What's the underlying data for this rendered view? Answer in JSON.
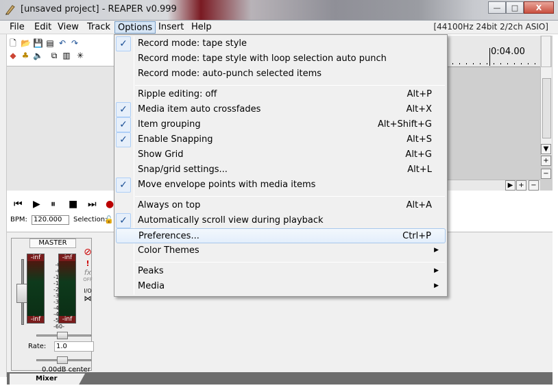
{
  "window": {
    "title": "[unsaved project] - REAPER v0.999",
    "minimize": "—",
    "maximize": "□",
    "close": "X"
  },
  "menubar": {
    "items": [
      "File",
      "Edit",
      "View",
      "Track",
      "Options",
      "Insert",
      "Help"
    ],
    "active": "Options",
    "status": "[44100Hz 24bit 2/2ch ASIO]"
  },
  "ruler": {
    "time": "0:04.00"
  },
  "transport": {
    "bpm_label": "BPM:",
    "bpm_value": "120.000",
    "selection_label": "Selection:"
  },
  "mixer": {
    "master_label": "MASTER",
    "meter_left_top": "-inf",
    "meter_right_top": "-inf",
    "meter_left_bottom": "-inf",
    "meter_right_bottom": "-inf",
    "scale": [
      "-0-",
      "-6-",
      "-12-",
      "-18-",
      "-24-",
      "-30-",
      "-36-",
      "-42-",
      "-48-",
      "-54-",
      "-60-"
    ],
    "fx_label": "fx",
    "fx_off": "OFF",
    "io_label": "I/O",
    "rate_label": "Rate:",
    "rate_value": "1.0",
    "volume_label": "0.00dB center",
    "tab_label": "Mixer"
  },
  "options_menu": {
    "items": [
      {
        "label": "Record mode: tape style",
        "shortcut": "",
        "checked": true
      },
      {
        "label": "Record mode: tape style with loop selection auto punch",
        "shortcut": "",
        "checked": false
      },
      {
        "label": "Record mode: auto-punch selected items",
        "shortcut": "",
        "checked": false
      },
      {
        "label": "Ripple editing: off",
        "shortcut": "Alt+P",
        "checked": false
      },
      {
        "label": "Media item auto crossfades",
        "shortcut": "Alt+X",
        "checked": true
      },
      {
        "label": "Item grouping",
        "shortcut": "Alt+Shift+G",
        "checked": true
      },
      {
        "label": "Enable Snapping",
        "shortcut": "Alt+S",
        "checked": true
      },
      {
        "label": "Show Grid",
        "shortcut": "Alt+G",
        "checked": false
      },
      {
        "label": "Snap/grid settings...",
        "shortcut": "Alt+L",
        "checked": false
      },
      {
        "label": "Move envelope points with media items",
        "shortcut": "",
        "checked": true
      },
      {
        "label": "Always on top",
        "shortcut": "Alt+A",
        "checked": false
      },
      {
        "label": "Automatically scroll view during playback",
        "shortcut": "",
        "checked": true
      },
      {
        "label": "Preferences...",
        "shortcut": "Ctrl+P",
        "checked": false
      },
      {
        "label": "Color Themes",
        "shortcut": "",
        "checked": false,
        "submenu": true
      },
      {
        "label": "Peaks",
        "shortcut": "",
        "checked": false,
        "submenu": true
      },
      {
        "label": "Media",
        "shortcut": "",
        "checked": false,
        "submenu": true
      }
    ],
    "check_glyph": "✓",
    "submenu_glyph": "▶"
  }
}
